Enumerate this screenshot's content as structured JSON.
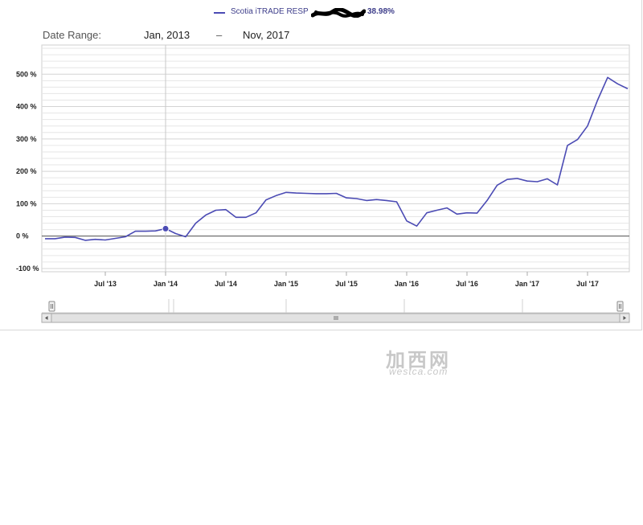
{
  "legend": {
    "series_name": "Scotia iTRADE RESP",
    "value": "38.98%",
    "line_color": "#4b4bb4"
  },
  "range": {
    "label": "Date Range:",
    "from": "Jan, 2013",
    "separator": "–",
    "to": "Nov, 2017"
  },
  "watermark": {
    "cn": "加西网",
    "site": "westca.com"
  },
  "chart_data": {
    "type": "line",
    "x_start": "2013-01",
    "x_end": "2017-11",
    "x_ticks": [
      "Jul '13",
      "Jan '14",
      "Jul '14",
      "Jan '15",
      "Jul '15",
      "Jan '16",
      "Jul '16",
      "Jan '17",
      "Jul '17"
    ],
    "y_ticks": [
      "500 %",
      "400 %",
      "300 %",
      "200 %",
      "100 %",
      "0 %",
      "-100 %"
    ],
    "ylim": [
      -110,
      590
    ],
    "grid": true,
    "highlighted_point": {
      "x": "Jan '14",
      "y": 23
    },
    "series": [
      {
        "name": "Scotia iTRADE RESP",
        "values": [
          -8,
          -8,
          -3,
          -4,
          -13,
          -10,
          -12,
          -7,
          -2,
          15,
          15,
          16,
          23,
          8,
          -2,
          40,
          65,
          80,
          82,
          58,
          58,
          72,
          112,
          125,
          135,
          133,
          132,
          131,
          131,
          132,
          118,
          116,
          110,
          113,
          110,
          106,
          47,
          31,
          72,
          80,
          87,
          68,
          72,
          71,
          110,
          157,
          175,
          178,
          170,
          168,
          177,
          158,
          280,
          298,
          340,
          420,
          490,
          470,
          455
        ],
        "color": "#4b4bb4"
      }
    ]
  }
}
